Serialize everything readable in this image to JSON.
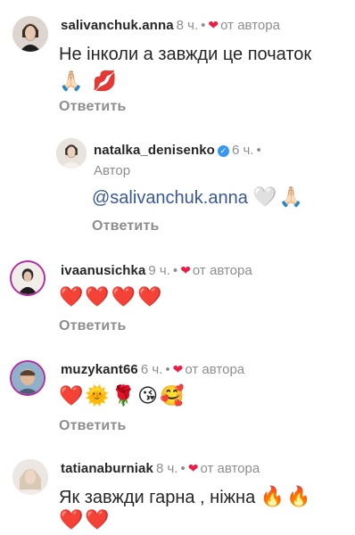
{
  "comments": [
    {
      "username": "salivanchuk.anna",
      "time": "8 ч.",
      "liked_label": "от автора",
      "text": "Не інколи а завжди це початок",
      "emoji_line": "🙏🏻 💋",
      "reply_label": "Ответить"
    },
    {
      "username": "natalka_denisenko",
      "time": "6 ч.",
      "author_tag": "Автор",
      "mention": "@salivanchuk.anna",
      "emoji_line": "🤍🙏🏻",
      "reply_label": "Ответить",
      "verified": true
    },
    {
      "username": "ivaanusichka",
      "time": "9 ч.",
      "liked_label": "от автора",
      "emoji_line": "❤️❤️❤️❤️",
      "reply_label": "Ответить"
    },
    {
      "username": "muzykant66",
      "time": "6 ч.",
      "liked_label": "от автора",
      "emoji_line": "❤️🌞🌹😘🥰",
      "reply_label": "Ответить"
    },
    {
      "username": "tatianaburniak",
      "time": "8 ч.",
      "liked_label": "от автора",
      "text": "Як завжди гарна , ніжна",
      "emoji_inline": "🔥🔥",
      "emoji_line": "❤️❤️"
    }
  ],
  "colors": {
    "heart": "#ed1c45",
    "meta_grey": "#8e8e8e",
    "mention_blue": "#385898",
    "verified_blue": "#3897f0",
    "story_ring": "#b32da0"
  },
  "icons": {
    "liked_by_author": "heart-icon",
    "verified": "verified-badge-icon"
  }
}
